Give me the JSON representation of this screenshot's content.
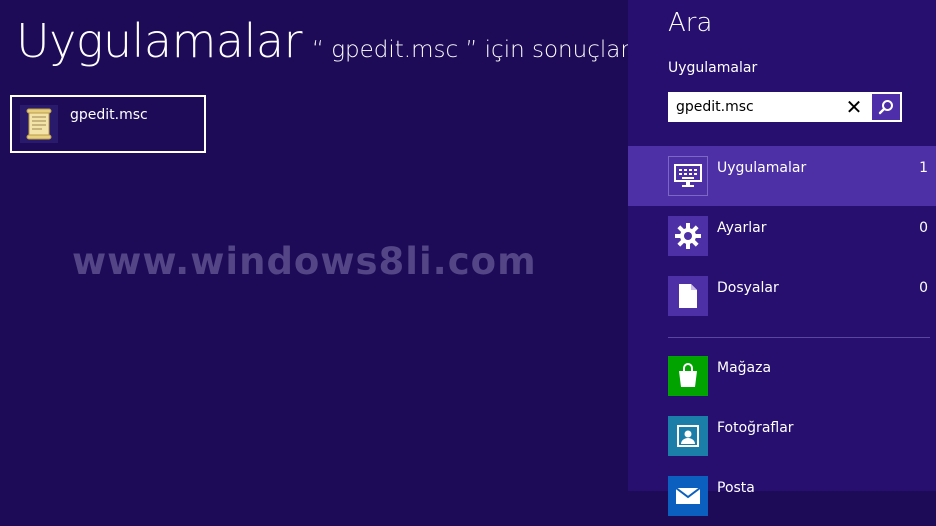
{
  "results": {
    "heading": "Uygulamalar",
    "subheading": "“ gpedit.msc ” için sonuçlar",
    "items": [
      {
        "label": "gpedit.msc",
        "icon": "scroll-document-icon"
      }
    ]
  },
  "watermark": "www.windows8li.com",
  "charm": {
    "title": "Ara",
    "scope": "Uygulamalar",
    "search": {
      "value": "gpedit.msc",
      "clear": "✕"
    },
    "categories": [
      {
        "label": "Uygulamalar",
        "count": "1",
        "icon": "apps-keyboard-icon",
        "active": true
      },
      {
        "label": "Ayarlar",
        "count": "0",
        "icon": "gear-icon",
        "active": false
      },
      {
        "label": "Dosyalar",
        "count": "0",
        "icon": "file-icon",
        "active": false
      }
    ],
    "apps": [
      {
        "label": "Mağaza",
        "icon": "store-bag-icon",
        "color": "#00a300"
      },
      {
        "label": "Fotoğraflar",
        "icon": "photos-icon",
        "color": "#1b7ea8"
      },
      {
        "label": "Posta",
        "icon": "mail-icon",
        "color": "#0a5fbf"
      }
    ]
  },
  "colors": {
    "background": "#1d0b58",
    "charm_background": "#260f6e",
    "accent": "#4d2fa6"
  }
}
